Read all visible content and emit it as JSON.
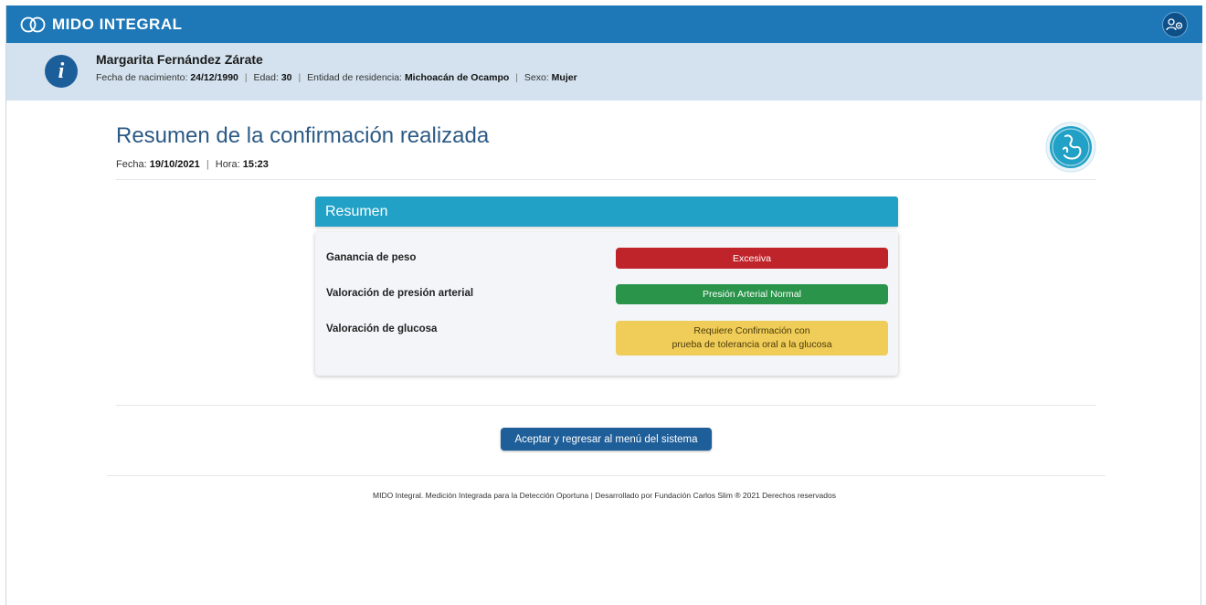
{
  "app": {
    "name": "MIDO INTEGRAL"
  },
  "patient": {
    "name": "Margarita Fernández Zárate",
    "birth_label": "Fecha de nacimiento:",
    "birth_value": "24/12/1990",
    "age_label": "Edad:",
    "age_value": "30",
    "residence_label": "Entidad de residencia:",
    "residence_value": "Michoacán de Ocampo",
    "sex_label": "Sexo:",
    "sex_value": "Mujer"
  },
  "page": {
    "title": "Resumen de la confirmación realizada",
    "date_label": "Fecha:",
    "date_value": "19/10/2021",
    "time_label": "Hora:",
    "time_value": "15:23"
  },
  "summary": {
    "header": "Resumen",
    "rows": [
      {
        "label": "Ganancia de peso",
        "result": "Excesiva",
        "status": "red"
      },
      {
        "label": "Valoración de presión arterial",
        "result": "Presión Arterial Normal",
        "status": "green"
      },
      {
        "label": "Valoración de glucosa",
        "result_line1": "Requiere Confirmación con",
        "result_line2": "prueba de tolerancia oral a la glucosa",
        "status": "yellow"
      }
    ]
  },
  "actions": {
    "accept_label": "Aceptar y regresar al menú del sistema"
  },
  "footer": {
    "text": "MIDO Integral. Medición Integrada para la Detección Oportuna | Desarrollado por Fundación Carlos Slim ® 2021 Derechos reservados"
  },
  "icons": {
    "logo": "infinity-logo-icon",
    "user": "user-settings-icon",
    "info": "info-icon",
    "emblem": "pregnancy-emblem-icon"
  },
  "colors": {
    "topbar": "#1e78b7",
    "patient_band": "#d3e2ee",
    "card_header": "#22a1c6",
    "status_red": "#c0242b",
    "status_green": "#2a944a",
    "status_yellow": "#f0cd59",
    "primary_button": "#1e5e99"
  }
}
